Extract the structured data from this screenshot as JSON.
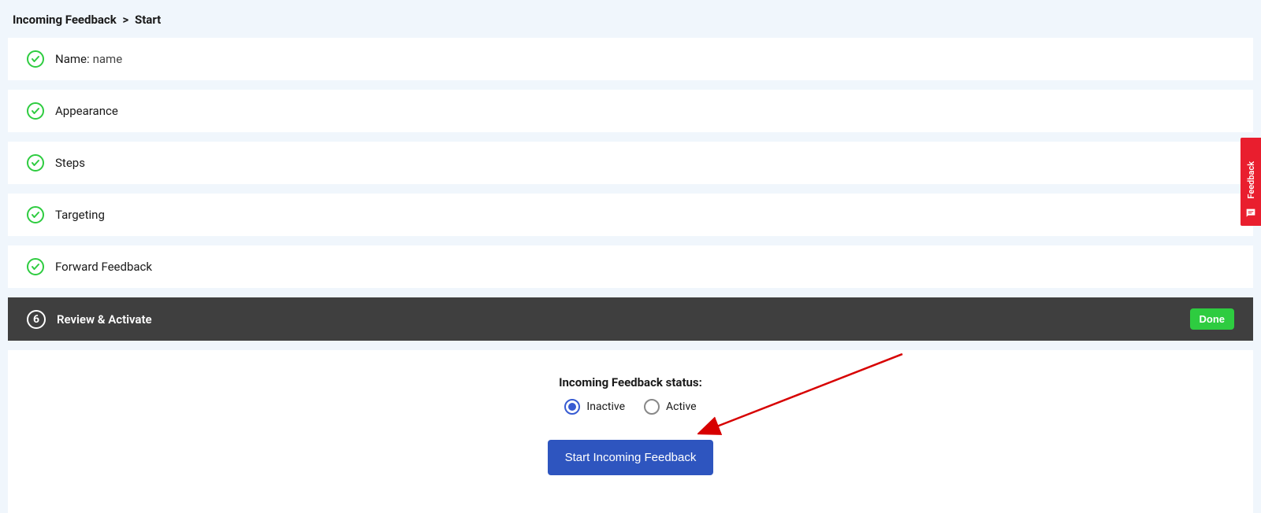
{
  "breadcrumb": {
    "root": "Incoming Feedback",
    "separator": ">",
    "current": "Start"
  },
  "steps": [
    {
      "label": "Name:",
      "value": "name",
      "completed": true
    },
    {
      "label": "Appearance",
      "completed": true
    },
    {
      "label": "Steps",
      "completed": true
    },
    {
      "label": "Targeting",
      "completed": true
    },
    {
      "label": "Forward Feedback",
      "completed": true
    }
  ],
  "activeStep": {
    "number": "6",
    "label": "Review & Activate",
    "doneLabel": "Done"
  },
  "review": {
    "statusLabel": "Incoming Feedback status:",
    "options": {
      "inactive": "Inactive",
      "active": "Active"
    },
    "selected": "inactive",
    "startButton": "Start Incoming Feedback"
  },
  "feedbackTab": {
    "label": "Feedback"
  }
}
